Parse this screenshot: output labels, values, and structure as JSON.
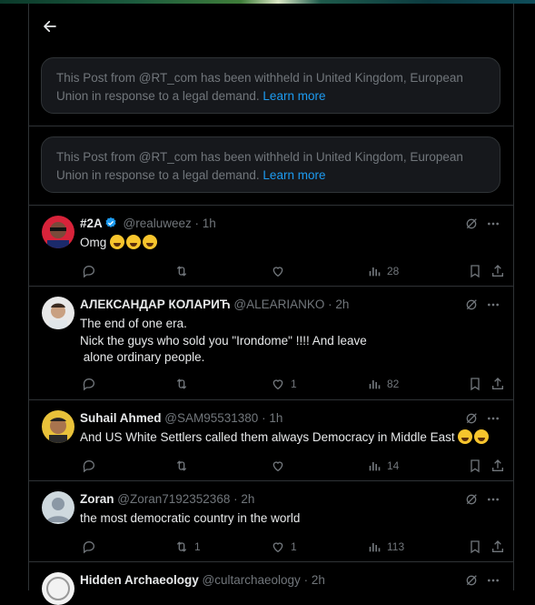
{
  "withheld_notices": [
    {
      "text": "This Post from @RT_com has been withheld in United Kingdom, European Union in response to a legal demand.",
      "link": "Learn more"
    },
    {
      "text": "This Post from @RT_com has been withheld in United Kingdom, European Union in response to a legal demand.",
      "link": "Learn more"
    }
  ],
  "posts": [
    {
      "name": "#2A",
      "handle": "@realuweez",
      "time": "1h",
      "text": "Omg",
      "emoji_count": 3,
      "replies": "",
      "reposts": "",
      "likes": "",
      "views": "28",
      "verified": true
    },
    {
      "name": "АЛЕКСАНДАР КОЛАРИЋ",
      "handle": "@ALEARIANKO",
      "time": "2h",
      "text": "The end of one era.\nNick the guys who sold you \"Irondome\" !!!! And leave\n alone ordinary people.",
      "replies": "",
      "reposts": "",
      "likes": "1",
      "views": "82",
      "verified": false
    },
    {
      "name": "Suhail Ahmed",
      "handle": "@SAM95531380",
      "time": "1h",
      "text": "And US White Settlers called them always Democracy in Middle East",
      "emoji_count": 2,
      "replies": "",
      "reposts": "",
      "likes": "",
      "views": "14",
      "verified": false
    },
    {
      "name": "Zoran",
      "handle": "@Zoran7192352368",
      "time": "2h",
      "text": "the most democratic country in the world",
      "replies": "",
      "reposts": "1",
      "likes": "1",
      "views": "113",
      "verified": false
    },
    {
      "name": "Hidden Archaeology",
      "handle": "@cultarchaeology",
      "time": "2h",
      "text": "",
      "replies": "",
      "reposts": "",
      "likes": "",
      "views": "",
      "verified": false
    }
  ],
  "separator": " · ",
  "colors": {
    "accent": "#1d9bf0",
    "muted": "#71767b",
    "text": "#e7e9ea",
    "border": "#2f3336"
  }
}
